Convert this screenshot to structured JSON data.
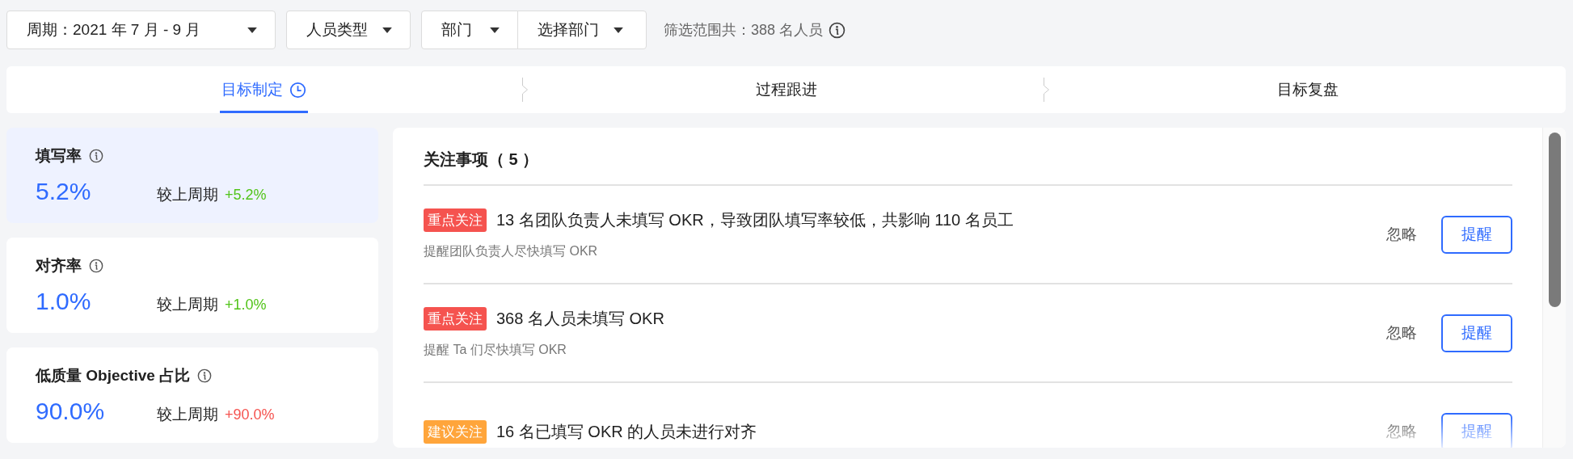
{
  "filters": [
    {
      "label": "周期：2021 年 7 月 - 9 月"
    },
    {
      "label": "人员类型"
    }
  ],
  "department_filter": {
    "label": "部门",
    "select": "选择部门"
  },
  "scope": {
    "text": "筛选范围共：388 名人员"
  },
  "steps": [
    {
      "label": "目标制定",
      "selected": true
    },
    {
      "label": "过程跟进",
      "selected": false
    },
    {
      "label": "目标复盘",
      "selected": false
    }
  ],
  "metrics": [
    {
      "title": "填写率",
      "value": "5.2%",
      "compare_label": "较上周期",
      "delta": "+5.2%",
      "color": "#52c41a",
      "selected": true
    },
    {
      "title": "对齐率",
      "value": "1.0%",
      "compare_label": "较上周期",
      "delta": "+1.0%",
      "color": "#52c41a",
      "selected": false
    },
    {
      "title": "低质量 Objective 占比",
      "value": "90.0%",
      "compare_label": "较上周期",
      "delta": "+90.0%",
      "color": "#f5534f",
      "selected": false
    }
  ],
  "attention": {
    "title": "关注事项（ 5 ）",
    "items": [
      {
        "tag": "重点关注",
        "color": "#f5534f",
        "title": "13 名团队负责人未填写 OKR，导致团队填写率较低，共影响 110 名员工",
        "subtitle": "提醒团队负责人尽快填写 OKR",
        "ignore": "忽略",
        "remind": "提醒"
      },
      {
        "tag": "重点关注",
        "color": "#f5534f",
        "title": "368 名人员未填写 OKR",
        "subtitle": "提醒 Ta 们尽快填写 OKR",
        "ignore": "忽略",
        "remind": "提醒"
      },
      {
        "tag": "建议关注",
        "color": "#ffa53b",
        "title": "16 名已填写 OKR 的人员未进行对齐",
        "ignore": "忽略",
        "remind": "提醒"
      }
    ]
  }
}
